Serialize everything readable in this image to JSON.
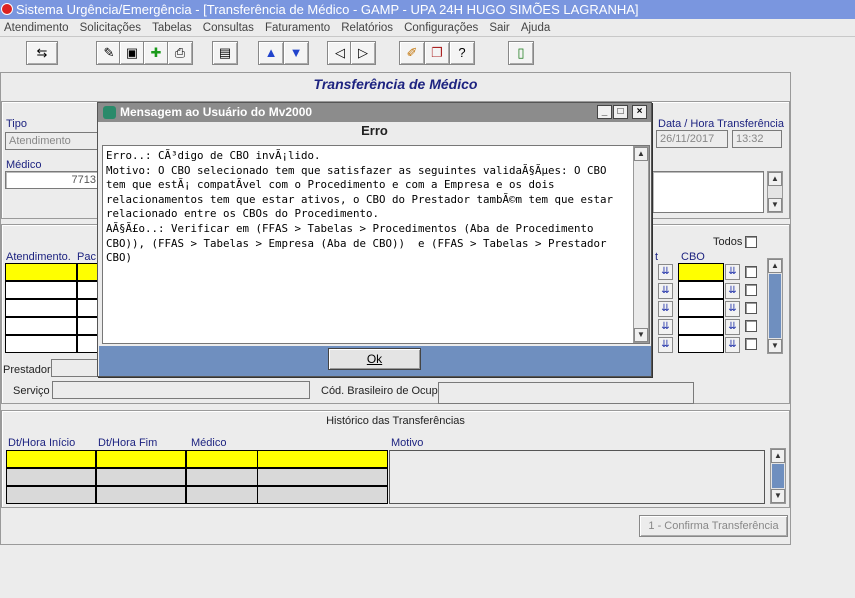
{
  "window": {
    "title": "Sistema Urgência/Emergência - [Transferência de Médico - GAMP - UPA 24H HUGO SIMÕES LAGRANHA]"
  },
  "menu": [
    "Atendimento",
    "Solicitações",
    "Tabelas",
    "Consultas",
    "Faturamento",
    "Relatórios",
    "Configurações",
    "Sair",
    "Ajuda"
  ],
  "toolbar": {
    "icons": [
      "exit-icon",
      "edit-icon",
      "save-icon",
      "add-icon",
      "print-icon",
      "clipboard-icon",
      "arrow-up-icon",
      "arrow-down-icon",
      "prev-icon",
      "next-icon",
      "pen-icon",
      "copy-icon",
      "help-icon",
      "door-icon"
    ]
  },
  "form": {
    "title": "Transferência de Médico",
    "tipo_label": "Tipo",
    "tipo_value": "Atendimento",
    "data_hora_label": "Data / Hora Transferência",
    "data_value": "26/11/2017",
    "hora_value": "13:32",
    "medico_label": "Médico",
    "medico_value": "7713",
    "todos_label": "Todos",
    "grid_headers": {
      "atendimento": "Atendimento.",
      "pac": "Pac",
      "t": "t",
      "cbo": "CBO"
    },
    "prestador_label": "Prestador",
    "servico_label": "Serviço",
    "cod_brasileiro_label": "Cód. Brasileiro de Ocup.",
    "historico_title": "Histórico das Transferências",
    "hist_headers": {
      "inicio": "Dt/Hora Início",
      "fim": "Dt/Hora Fim",
      "medico": "Médico",
      "motivo": "Motivo"
    },
    "confirm_button": "1 - Confirma Transferência"
  },
  "dialog": {
    "title": "Mensagem ao Usuário do Mv2000",
    "heading": "Erro",
    "message": "Erro..: CÃ³digo de CBO invÃ¡lido.\nMotivo: O CBO selecionado tem que satisfazer as seguintes validaÃ§Ãµes: O CBO tem que estÃ¡ compatÃ­vel com o Procedimento e com a Empresa e os dois relacionamentos tem que estar ativos, o CBO do Prestador tambÃ©m tem que estar relacionado entre os CBOs do Procedimento.\nAÃ§Ã£o..: Verificar em (FFAS > Tabelas > Procedimentos (Aba de Procedimento CBO)), (FFAS > Tabelas > Empresa (Aba de CBO))  e (FFAS > Tabelas > Prestador CBO)",
    "ok_button": "Ok"
  }
}
